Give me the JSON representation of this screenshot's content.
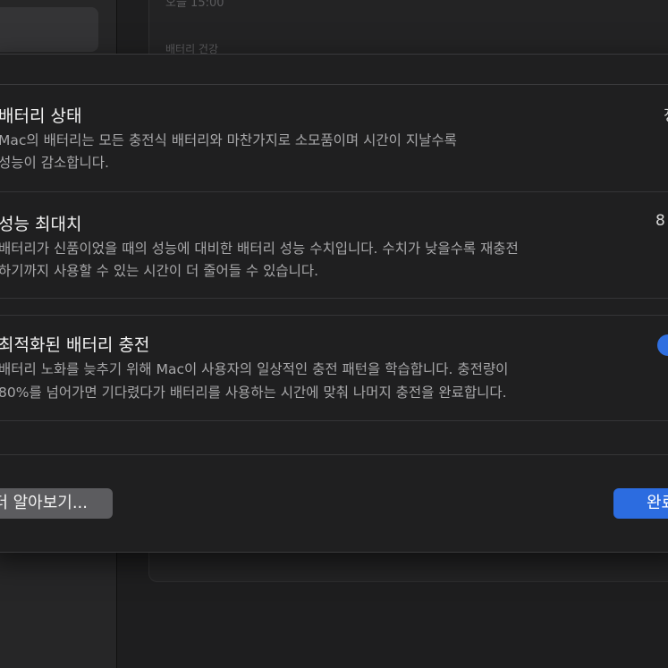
{
  "background": {
    "faded_time": "오늘 15:00",
    "faded_label": "배터리 건강"
  },
  "sections": {
    "battery_state": {
      "title": "배터리 상태",
      "value": "정",
      "desc_line1": "Mac의 배터리는 모든 충전식 배터리와 마찬가지로 소모품이며 시간이 지날수록",
      "desc_line2": "성능이 감소합니다."
    },
    "max_capacity": {
      "title": "성능 최대치",
      "value": "8",
      "desc_line1": "배터리가 신품이었을 때의 성능에 대비한 배터리 성능 수치입니다. 수치가 낮을수록 재충전",
      "desc_line2": "하기까지 사용할 수 있는 시간이 더 줄어들 수 있습니다."
    },
    "optimized_charging": {
      "title": "최적화된 배터리 충전",
      "enabled": true,
      "desc_line1": "배터리 노화를 늦추기 위해 Mac이 사용자의 일상적인 충전 패턴을 학습합니다. 충전량이",
      "desc_line2": "80%를 넘어가면 기다렸다가 배터리를 사용하는 시간에 맞춰 나머지 충전을 완료합니다."
    }
  },
  "buttons": {
    "learn_more": "더 알아보기...",
    "done": "완료"
  },
  "colors": {
    "accent": "#2c6ce0",
    "sheet_bg": "#1f1f20"
  }
}
